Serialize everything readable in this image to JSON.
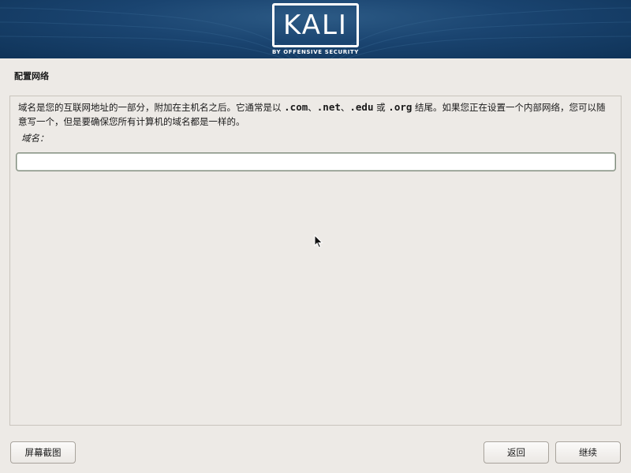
{
  "header": {
    "logo_text": "KALI",
    "logo_subtitle": "BY OFFENSIVE SECURITY",
    "colors": {
      "banner_dark": "#0f3358",
      "banner_light": "#2c5a85",
      "logo": "#ffffff"
    }
  },
  "page": {
    "title": "配置网络",
    "description": {
      "part1": "域名是您的互联网地址的一部分，附加在主机名之后。它通常是以 ",
      "com": ".com",
      "sep1": "、",
      "net": ".net",
      "sep2": "、",
      "edu": ".edu",
      "or": " 或 ",
      "org": ".org",
      "part2": " 结尾。如果您正在设置一个内部网络，您可以随意写一个，但是要确保您所有计算机的域名都是一样的。"
    },
    "field_label": "域名：",
    "domain_value": ""
  },
  "buttons": {
    "screenshot": "屏幕截图",
    "back": "返回",
    "continue": "继续"
  },
  "icons": {
    "pointer": "mouse-pointer-icon"
  }
}
